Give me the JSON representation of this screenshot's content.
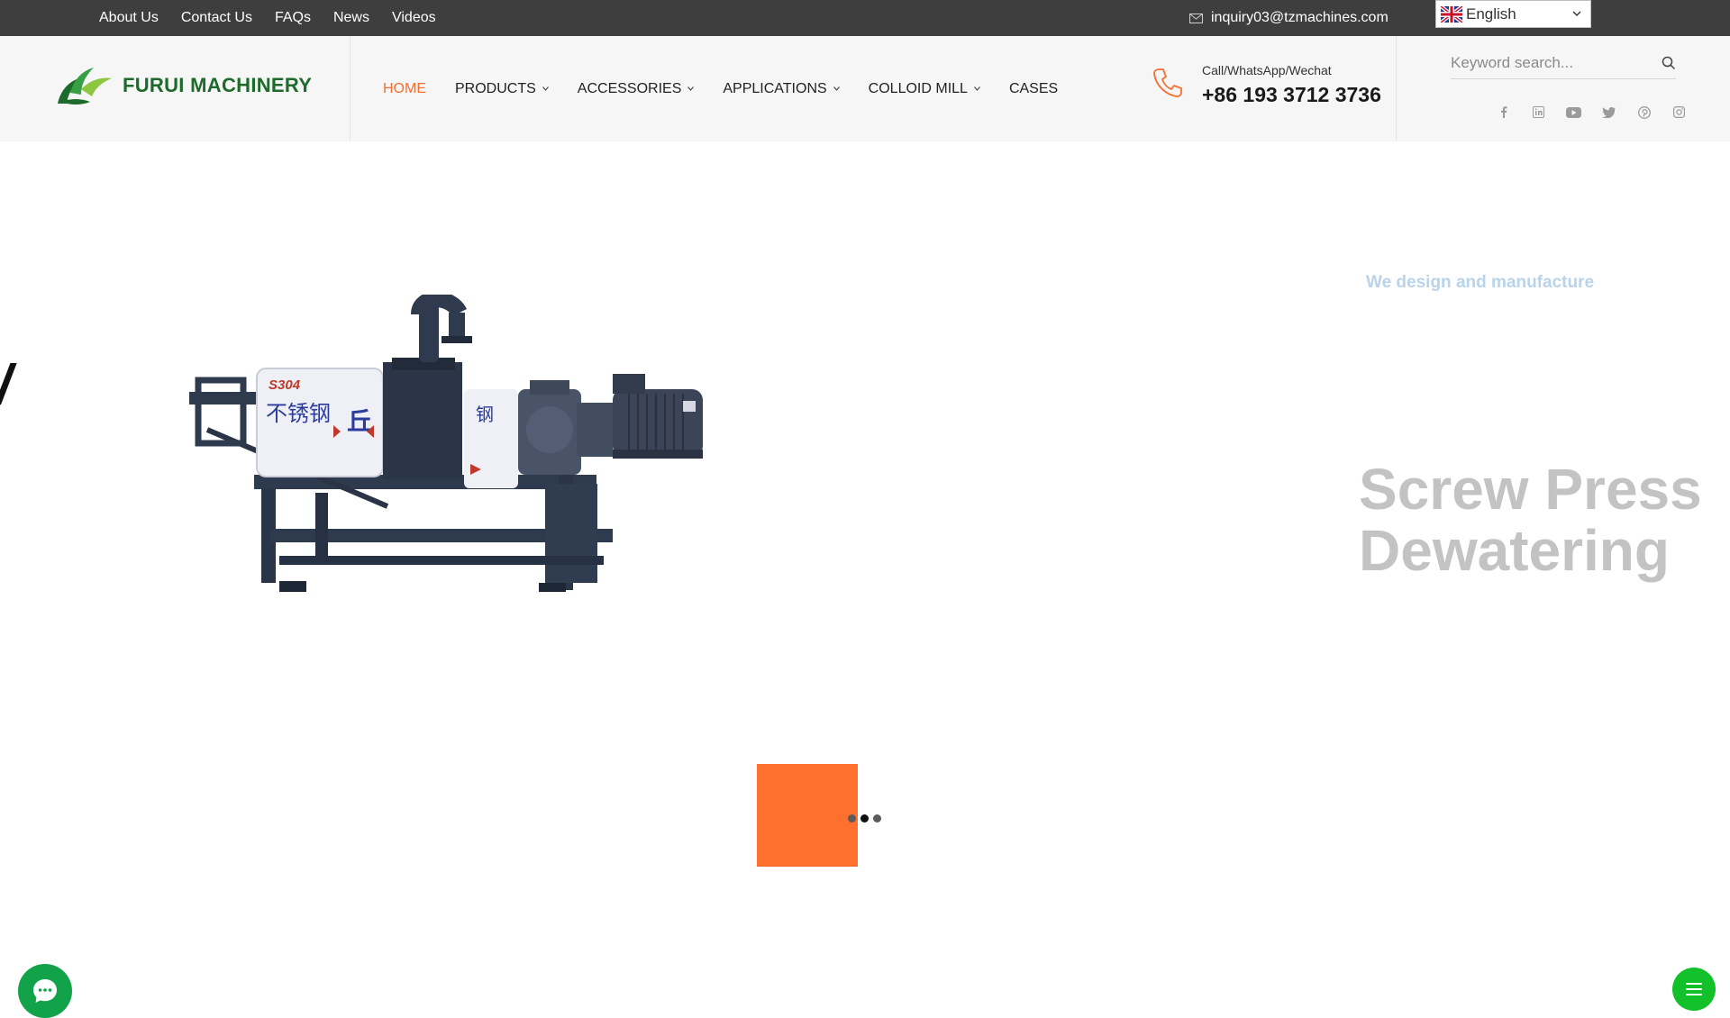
{
  "topbar": {
    "links": [
      "About Us",
      "Contact Us",
      "FAQs",
      "News",
      "Videos"
    ],
    "email": "inquiry03@tzmachines.com",
    "language": "English"
  },
  "header": {
    "logo_text": "FURUI MACHINERY",
    "nav": [
      {
        "label": "HOME",
        "active": true
      },
      {
        "label": "PRODUCTS"
      },
      {
        "label": "ACCESSORIES"
      },
      {
        "label": "APPLICATIONS"
      },
      {
        "label": "COLLOID MILL"
      },
      {
        "label": "CASES"
      }
    ],
    "contact_label": "Call/WhatsApp/Wechat",
    "phone": "+86 193 3712 3736",
    "search_placeholder": "Keyword search...",
    "social": [
      "facebook-icon",
      "linkedin-icon",
      "youtube-icon",
      "twitter-icon",
      "pinterest-icon",
      "instagram-icon"
    ]
  },
  "hero": {
    "partial_glyph": "/",
    "tagline": "We design and manufacture",
    "title_line1": "Screw Press",
    "title_line2": "Dewatering",
    "machine_labels": {
      "grade": "S304",
      "chinese": "不锈钢",
      "brand_mark": "丘"
    },
    "active_slide": 2,
    "slide_count": 3
  },
  "colors": {
    "accent": "#f26f31",
    "brand_green": "#1d6b2a",
    "topbar_bg": "#3e3e3e",
    "chat_green": "#12a24a"
  }
}
